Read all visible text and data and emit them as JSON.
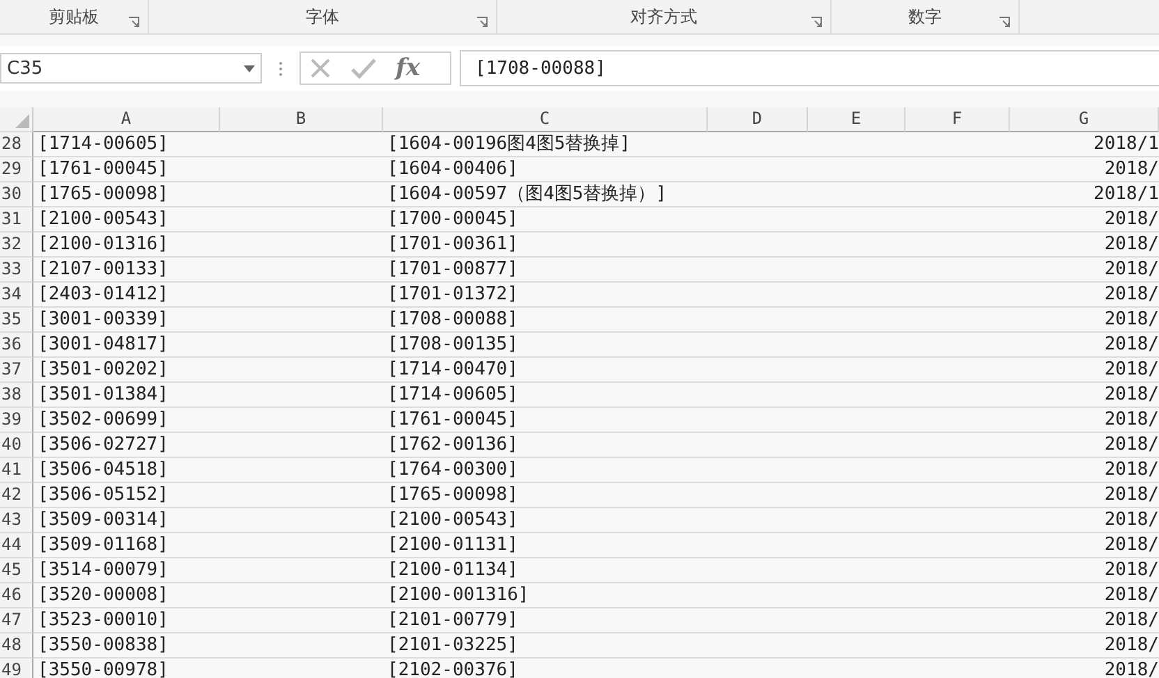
{
  "ribbon_groups": [
    "剪贴板",
    "字体",
    "对齐方式",
    "数字"
  ],
  "name_box": "C35",
  "formula": "[1708-00088]",
  "formula_button": "fx",
  "columns": [
    "A",
    "B",
    "C",
    "D",
    "E",
    "F",
    "G"
  ],
  "rows": [
    {
      "number": "28",
      "a": "[1714-00605]",
      "c": "[1604-00196图4图5替换掉]",
      "g": "2018/1"
    },
    {
      "number": "29",
      "a": "[1761-00045]",
      "c": "[1604-00406]",
      "g": "2018/"
    },
    {
      "number": "30",
      "a": "[1765-00098]",
      "c": "[1604-00597（图4图5替换掉）]",
      "g": "2018/1"
    },
    {
      "number": "31",
      "a": "[2100-00543]",
      "c": "[1700-00045]",
      "g": "2018/"
    },
    {
      "number": "32",
      "a": "[2100-01316]",
      "c": "[1701-00361]",
      "g": "2018/"
    },
    {
      "number": "33",
      "a": "[2107-00133]",
      "c": "[1701-00877]",
      "g": "2018/"
    },
    {
      "number": "34",
      "a": "[2403-01412]",
      "c": "[1701-01372]",
      "g": "2018/"
    },
    {
      "number": "35",
      "a": "[3001-00339]",
      "c": "[1708-00088]",
      "g": "2018/"
    },
    {
      "number": "36",
      "a": "[3001-04817]",
      "c": "[1708-00135]",
      "g": "2018/"
    },
    {
      "number": "37",
      "a": "[3501-00202]",
      "c": "[1714-00470]",
      "g": "2018/"
    },
    {
      "number": "38",
      "a": "[3501-01384]",
      "c": "[1714-00605]",
      "g": "2018/"
    },
    {
      "number": "39",
      "a": "[3502-00699]",
      "c": "[1761-00045]",
      "g": "2018/"
    },
    {
      "number": "40",
      "a": "[3506-02727]",
      "c": "[1762-00136]",
      "g": "2018/"
    },
    {
      "number": "41",
      "a": "[3506-04518]",
      "c": "[1764-00300]",
      "g": "2018/"
    },
    {
      "number": "42",
      "a": "[3506-05152]",
      "c": "[1765-00098]",
      "g": "2018/"
    },
    {
      "number": "43",
      "a": "[3509-00314]",
      "c": "[2100-00543]",
      "g": "2018/"
    },
    {
      "number": "44",
      "a": "[3509-01168]",
      "c": "[2100-01131]",
      "g": "2018/"
    },
    {
      "number": "45",
      "a": "[3514-00079]",
      "c": "[2100-01134]",
      "g": "2018/"
    },
    {
      "number": "46",
      "a": "[3520-00008]",
      "c": "[2100-001316]",
      "g": "2018/"
    },
    {
      "number": "47",
      "a": "[3523-00010]",
      "c": "[2101-00779]",
      "g": "2018/"
    },
    {
      "number": "48",
      "a": "[3550-00838]",
      "c": "[2101-03225]",
      "g": "2018/"
    },
    {
      "number": "49",
      "a": "[3550-00978]",
      "c": "[2102-00376]",
      "g": "2018/"
    }
  ]
}
